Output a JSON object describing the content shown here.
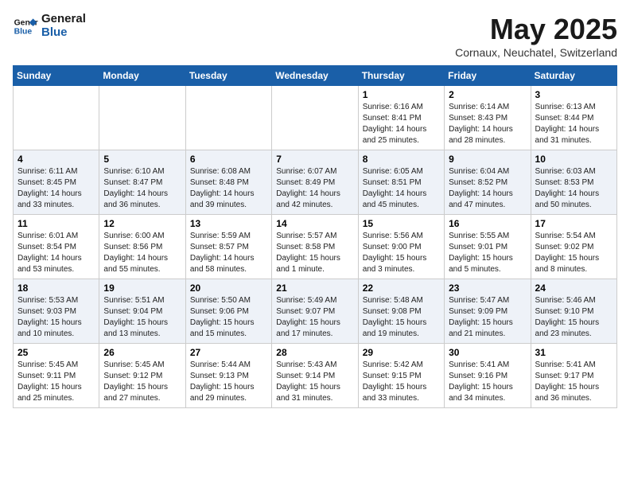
{
  "header": {
    "logo_line1": "General",
    "logo_line2": "Blue",
    "month_title": "May 2025",
    "location": "Cornaux, Neuchatel, Switzerland"
  },
  "weekdays": [
    "Sunday",
    "Monday",
    "Tuesday",
    "Wednesday",
    "Thursday",
    "Friday",
    "Saturday"
  ],
  "weeks": [
    [
      {
        "day": "",
        "info": ""
      },
      {
        "day": "",
        "info": ""
      },
      {
        "day": "",
        "info": ""
      },
      {
        "day": "",
        "info": ""
      },
      {
        "day": "1",
        "info": "Sunrise: 6:16 AM\nSunset: 8:41 PM\nDaylight: 14 hours\nand 25 minutes."
      },
      {
        "day": "2",
        "info": "Sunrise: 6:14 AM\nSunset: 8:43 PM\nDaylight: 14 hours\nand 28 minutes."
      },
      {
        "day": "3",
        "info": "Sunrise: 6:13 AM\nSunset: 8:44 PM\nDaylight: 14 hours\nand 31 minutes."
      }
    ],
    [
      {
        "day": "4",
        "info": "Sunrise: 6:11 AM\nSunset: 8:45 PM\nDaylight: 14 hours\nand 33 minutes."
      },
      {
        "day": "5",
        "info": "Sunrise: 6:10 AM\nSunset: 8:47 PM\nDaylight: 14 hours\nand 36 minutes."
      },
      {
        "day": "6",
        "info": "Sunrise: 6:08 AM\nSunset: 8:48 PM\nDaylight: 14 hours\nand 39 minutes."
      },
      {
        "day": "7",
        "info": "Sunrise: 6:07 AM\nSunset: 8:49 PM\nDaylight: 14 hours\nand 42 minutes."
      },
      {
        "day": "8",
        "info": "Sunrise: 6:05 AM\nSunset: 8:51 PM\nDaylight: 14 hours\nand 45 minutes."
      },
      {
        "day": "9",
        "info": "Sunrise: 6:04 AM\nSunset: 8:52 PM\nDaylight: 14 hours\nand 47 minutes."
      },
      {
        "day": "10",
        "info": "Sunrise: 6:03 AM\nSunset: 8:53 PM\nDaylight: 14 hours\nand 50 minutes."
      }
    ],
    [
      {
        "day": "11",
        "info": "Sunrise: 6:01 AM\nSunset: 8:54 PM\nDaylight: 14 hours\nand 53 minutes."
      },
      {
        "day": "12",
        "info": "Sunrise: 6:00 AM\nSunset: 8:56 PM\nDaylight: 14 hours\nand 55 minutes."
      },
      {
        "day": "13",
        "info": "Sunrise: 5:59 AM\nSunset: 8:57 PM\nDaylight: 14 hours\nand 58 minutes."
      },
      {
        "day": "14",
        "info": "Sunrise: 5:57 AM\nSunset: 8:58 PM\nDaylight: 15 hours\nand 1 minute."
      },
      {
        "day": "15",
        "info": "Sunrise: 5:56 AM\nSunset: 9:00 PM\nDaylight: 15 hours\nand 3 minutes."
      },
      {
        "day": "16",
        "info": "Sunrise: 5:55 AM\nSunset: 9:01 PM\nDaylight: 15 hours\nand 5 minutes."
      },
      {
        "day": "17",
        "info": "Sunrise: 5:54 AM\nSunset: 9:02 PM\nDaylight: 15 hours\nand 8 minutes."
      }
    ],
    [
      {
        "day": "18",
        "info": "Sunrise: 5:53 AM\nSunset: 9:03 PM\nDaylight: 15 hours\nand 10 minutes."
      },
      {
        "day": "19",
        "info": "Sunrise: 5:51 AM\nSunset: 9:04 PM\nDaylight: 15 hours\nand 13 minutes."
      },
      {
        "day": "20",
        "info": "Sunrise: 5:50 AM\nSunset: 9:06 PM\nDaylight: 15 hours\nand 15 minutes."
      },
      {
        "day": "21",
        "info": "Sunrise: 5:49 AM\nSunset: 9:07 PM\nDaylight: 15 hours\nand 17 minutes."
      },
      {
        "day": "22",
        "info": "Sunrise: 5:48 AM\nSunset: 9:08 PM\nDaylight: 15 hours\nand 19 minutes."
      },
      {
        "day": "23",
        "info": "Sunrise: 5:47 AM\nSunset: 9:09 PM\nDaylight: 15 hours\nand 21 minutes."
      },
      {
        "day": "24",
        "info": "Sunrise: 5:46 AM\nSunset: 9:10 PM\nDaylight: 15 hours\nand 23 minutes."
      }
    ],
    [
      {
        "day": "25",
        "info": "Sunrise: 5:45 AM\nSunset: 9:11 PM\nDaylight: 15 hours\nand 25 minutes."
      },
      {
        "day": "26",
        "info": "Sunrise: 5:45 AM\nSunset: 9:12 PM\nDaylight: 15 hours\nand 27 minutes."
      },
      {
        "day": "27",
        "info": "Sunrise: 5:44 AM\nSunset: 9:13 PM\nDaylight: 15 hours\nand 29 minutes."
      },
      {
        "day": "28",
        "info": "Sunrise: 5:43 AM\nSunset: 9:14 PM\nDaylight: 15 hours\nand 31 minutes."
      },
      {
        "day": "29",
        "info": "Sunrise: 5:42 AM\nSunset: 9:15 PM\nDaylight: 15 hours\nand 33 minutes."
      },
      {
        "day": "30",
        "info": "Sunrise: 5:41 AM\nSunset: 9:16 PM\nDaylight: 15 hours\nand 34 minutes."
      },
      {
        "day": "31",
        "info": "Sunrise: 5:41 AM\nSunset: 9:17 PM\nDaylight: 15 hours\nand 36 minutes."
      }
    ]
  ]
}
